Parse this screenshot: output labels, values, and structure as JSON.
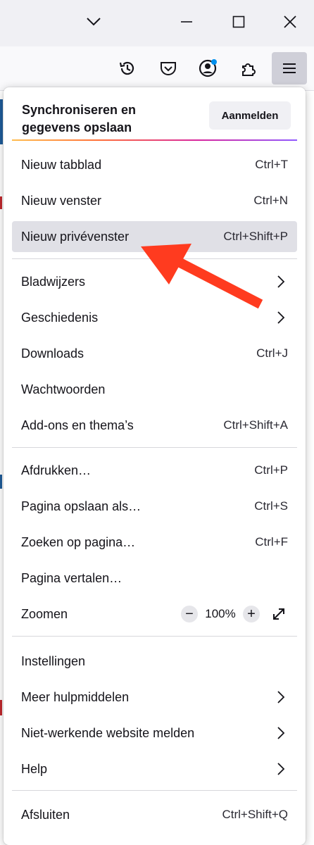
{
  "toolbar": {
    "icons": [
      "history-icon",
      "pocket-icon",
      "account-icon",
      "extensions-icon",
      "hamburger-menu-icon"
    ]
  },
  "menu": {
    "sync_title": "Synchroniseren en gegevens opslaan",
    "signin_label": "Aanmelden",
    "items": [
      {
        "label": "Nieuw tabblad",
        "shortcut": "Ctrl+T"
      },
      {
        "label": "Nieuw venster",
        "shortcut": "Ctrl+N"
      },
      {
        "label": "Nieuw privévenster",
        "shortcut": "Ctrl+Shift+P"
      },
      {
        "label": "Bladwijzers",
        "shortcut": ""
      },
      {
        "label": "Geschiedenis",
        "shortcut": ""
      },
      {
        "label": "Downloads",
        "shortcut": "Ctrl+J"
      },
      {
        "label": "Wachtwoorden",
        "shortcut": ""
      },
      {
        "label": "Add-ons en thema’s",
        "shortcut": "Ctrl+Shift+A"
      },
      {
        "label": "Afdrukken…",
        "shortcut": "Ctrl+P"
      },
      {
        "label": "Pagina opslaan als…",
        "shortcut": "Ctrl+S"
      },
      {
        "label": "Zoeken op pagina…",
        "shortcut": "Ctrl+F"
      },
      {
        "label": "Pagina vertalen…",
        "shortcut": ""
      },
      {
        "label": "Zoomen",
        "shortcut": ""
      },
      {
        "label": "Instellingen",
        "shortcut": ""
      },
      {
        "label": "Meer hulpmiddelen",
        "shortcut": ""
      },
      {
        "label": "Niet-werkende website melden",
        "shortcut": ""
      },
      {
        "label": "Help",
        "shortcut": ""
      },
      {
        "label": "Afsluiten",
        "shortcut": "Ctrl+Shift+Q"
      }
    ],
    "zoom": {
      "minus": "−",
      "value": "100%",
      "plus": "+"
    }
  },
  "colors": {
    "highlight": "#e0e0e6",
    "arrow": "#ff3b1f",
    "badge": "#0090ed"
  }
}
